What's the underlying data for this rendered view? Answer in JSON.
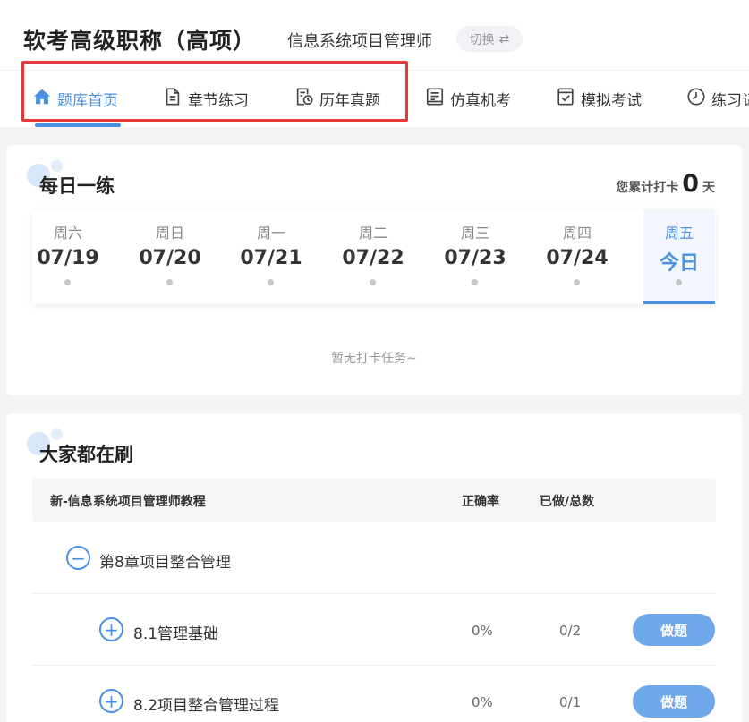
{
  "header": {
    "title": "软考高级职称（高项）",
    "subject": "信息系统项目管理师",
    "switch_label": "切换",
    "switch_icon": "⇄"
  },
  "tabs": [
    {
      "label": "题库首页",
      "icon": "home-icon",
      "active": true
    },
    {
      "label": "章节练习",
      "icon": "document-icon",
      "active": false
    },
    {
      "label": "历年真题",
      "icon": "exam-history-icon",
      "active": false
    },
    {
      "label": "仿真机考",
      "icon": "computer-exam-icon",
      "active": false
    },
    {
      "label": "模拟考试",
      "icon": "mock-exam-icon",
      "active": false
    },
    {
      "label": "练习记",
      "icon": "clock-icon",
      "active": false
    }
  ],
  "daily": {
    "title": "每日一练",
    "streak_prefix": "您累计打卡",
    "streak_count": "0",
    "streak_suffix": "天",
    "days": [
      {
        "weekday": "周六",
        "date": "07/19"
      },
      {
        "weekday": "周日",
        "date": "07/20"
      },
      {
        "weekday": "周一",
        "date": "07/21"
      },
      {
        "weekday": "周二",
        "date": "07/22"
      },
      {
        "weekday": "周三",
        "date": "07/23"
      },
      {
        "weekday": "周四",
        "date": "07/24"
      },
      {
        "weekday": "周五",
        "date": "今日"
      }
    ],
    "empty_text": "暂无打卡任务~"
  },
  "popular": {
    "title": "大家都在刷",
    "columns": {
      "book": "新-信息系统项目管理师教程",
      "accuracy": "正确率",
      "progress": "已做/总数"
    },
    "chapter": {
      "toggle": "−",
      "name": "第8章项目整合管理"
    },
    "sections": [
      {
        "toggle": "+",
        "name": "8.1管理基础",
        "accuracy": "0%",
        "progress": "0/2",
        "button": "做题"
      },
      {
        "toggle": "+",
        "name": "8.2项目整合管理过程",
        "accuracy": "0%",
        "progress": "0/1",
        "button": "做题"
      }
    ]
  },
  "colors": {
    "accent": "#4a90e2",
    "button": "#6ea7ea",
    "highlight_box": "#e53935"
  }
}
